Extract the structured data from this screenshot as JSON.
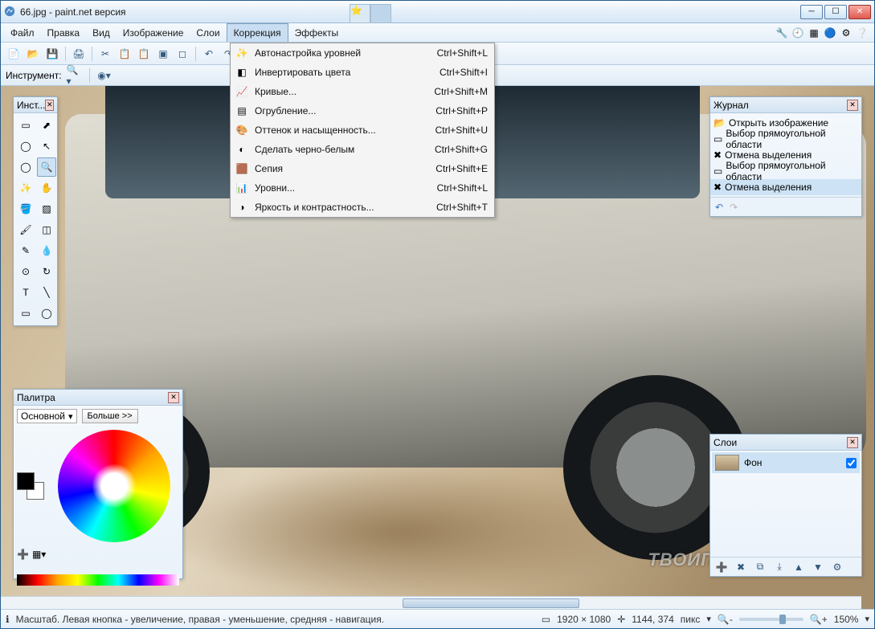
{
  "title": "66.jpg - paint.net версия",
  "menubar": [
    "Файл",
    "Правка",
    "Вид",
    "Изображение",
    "Слои",
    "Коррекция",
    "Эффекты"
  ],
  "active_menu": "Коррекция",
  "subtoolbar_label": "Инструмент:",
  "dropdown": [
    {
      "label": "Автонастройка уровней",
      "shortcut": "Ctrl+Shift+L"
    },
    {
      "label": "Инвертировать цвета",
      "shortcut": "Ctrl+Shift+I"
    },
    {
      "label": "Кривые...",
      "shortcut": "Ctrl+Shift+M"
    },
    {
      "label": "Огрубление...",
      "shortcut": "Ctrl+Shift+P"
    },
    {
      "label": "Оттенок и насыщенность...",
      "shortcut": "Ctrl+Shift+U"
    },
    {
      "label": "Сделать черно-белым",
      "shortcut": "Ctrl+Shift+G"
    },
    {
      "label": "Сепия",
      "shortcut": "Ctrl+Shift+E"
    },
    {
      "label": "Уровни...",
      "shortcut": "Ctrl+Shift+L"
    },
    {
      "label": "Яркость и контрастность...",
      "shortcut": "Ctrl+Shift+T"
    }
  ],
  "tools_panel": {
    "title": "Инст..."
  },
  "history_panel": {
    "title": "Журнал",
    "items": [
      "Открыть изображение",
      "Выбор прямоугольной области",
      "Отмена выделения",
      "Выбор прямоугольной области",
      "Отмена выделения"
    ],
    "selected": 4
  },
  "palette_panel": {
    "title": "Палитра",
    "selector": "Основной",
    "more": "Больше >>"
  },
  "layers_panel": {
    "title": "Слои",
    "layer_name": "Фон"
  },
  "statusbar": {
    "hint": "Масштаб. Левая кнопка - увеличение, правая - уменьшение, средняя - навигация.",
    "dimensions": "1920 × 1080",
    "coords": "1144, 374",
    "units": "пикс",
    "zoom": "150%"
  },
  "watermark": "ТВОИПРОГРАММЫ.РУ"
}
